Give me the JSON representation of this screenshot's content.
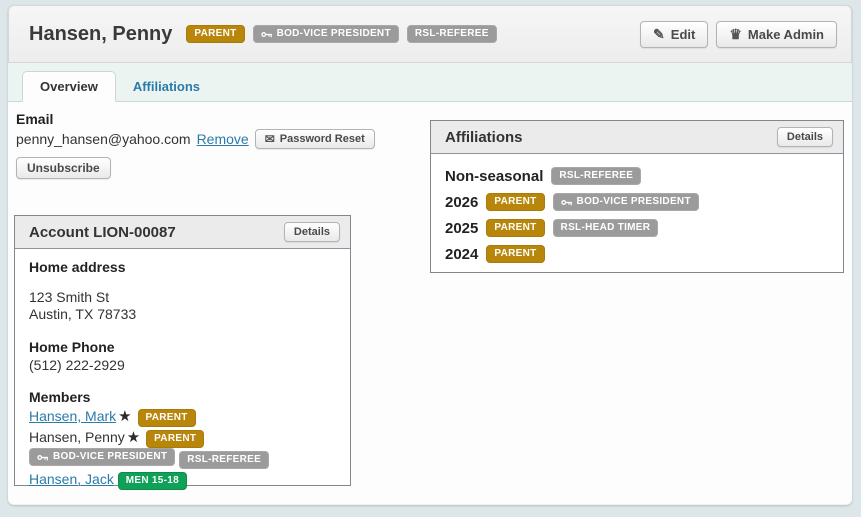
{
  "header": {
    "name": "Hansen, Penny",
    "badges": [
      {
        "label": "PARENT",
        "type": "gold"
      },
      {
        "label": "BOD-VICE PRESIDENT",
        "type": "gray",
        "key_icon": true
      },
      {
        "label": "RSL-REFEREE",
        "type": "gray"
      }
    ],
    "edit_label": "Edit",
    "make_admin_label": "Make Admin"
  },
  "tabs": [
    {
      "label": "Overview",
      "active": true
    },
    {
      "label": "Affiliations",
      "active": false
    }
  ],
  "email": {
    "heading": "Email",
    "address": "penny_hansen@yahoo.com",
    "remove_label": "Remove",
    "password_reset_label": "Password Reset",
    "unsubscribe_label": "Unsubscribe"
  },
  "account": {
    "title": "Account LION-00087",
    "details_label": "Details",
    "home_address_heading": "Home address",
    "address_lines": [
      "123 Smith St",
      "Austin, TX 78733"
    ],
    "home_phone_heading": "Home Phone",
    "phone": "(512) 222-2929",
    "members_heading": "Members",
    "members": [
      {
        "name": "Hansen, Mark",
        "link": true,
        "star": "★",
        "badges": [
          {
            "label": "PARENT",
            "type": "gold"
          }
        ]
      },
      {
        "name": "Hansen, Penny",
        "link": false,
        "star": "★",
        "badges": [
          {
            "label": "PARENT",
            "type": "gold"
          },
          {
            "label": "BOD-VICE PRESIDENT",
            "type": "gray",
            "key_icon": true
          },
          {
            "label": "RSL-REFEREE",
            "type": "gray"
          }
        ]
      },
      {
        "name": "Hansen, Jack",
        "link": true,
        "badges": [
          {
            "label": "MEN 15-18",
            "type": "green"
          }
        ]
      }
    ]
  },
  "affiliations": {
    "title": "Affiliations",
    "details_label": "Details",
    "rows": [
      {
        "period": "Non-seasonal",
        "badges": [
          {
            "label": "RSL-REFEREE",
            "type": "gray"
          }
        ]
      },
      {
        "period": "2026",
        "badges": [
          {
            "label": "PARENT",
            "type": "gold"
          },
          {
            "label": "BOD-VICE PRESIDENT",
            "type": "gray",
            "key_icon": true
          }
        ]
      },
      {
        "period": "2025",
        "badges": [
          {
            "label": "PARENT",
            "type": "gold"
          },
          {
            "label": "RSL-HEAD TIMER",
            "type": "gray"
          }
        ]
      },
      {
        "period": "2024",
        "badges": [
          {
            "label": "PARENT",
            "type": "gold"
          }
        ]
      }
    ]
  },
  "colors": {
    "badge_gold": "#b8860b",
    "badge_gray": "#9b9b9b",
    "badge_green": "#0ea157",
    "link_blue": "#2a7ba9",
    "page_background": "#dde7e9"
  }
}
